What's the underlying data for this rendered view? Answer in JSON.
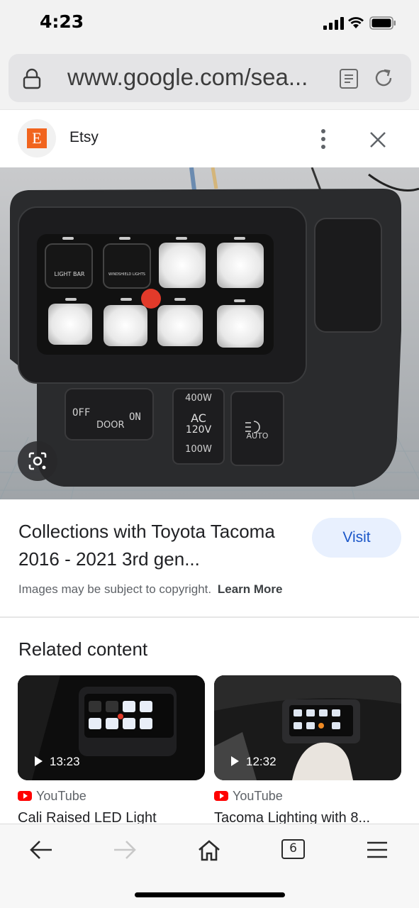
{
  "status_bar": {
    "time": "4:23"
  },
  "address_bar": {
    "url": "www.google.com/sea..."
  },
  "source": {
    "favicon_letter": "E",
    "name": "Etsy",
    "favicon_color": "#f1641e"
  },
  "image": {
    "switch_labels": [
      "LIGHT BAR",
      "WINDSHIELD LIGHTS"
    ],
    "lower_switch": {
      "off": "OFF",
      "on": "ON",
      "label": "DOOR"
    },
    "inverter": {
      "top": "400W",
      "ac": "AC",
      "voltage": "120V",
      "bottom": "100W"
    },
    "auto_label": "AUTO"
  },
  "info": {
    "title": "Collections with Toyota Tacoma 2016 - 2021 3rd gen...",
    "visit_label": "Visit",
    "copyright": "Images may be subject to copyright.",
    "learn_more": "Learn More"
  },
  "related": {
    "heading": "Related content",
    "cards": [
      {
        "duration": "13:23",
        "source": "YouTube",
        "title": "Cali Raised LED Light"
      },
      {
        "duration": "12:32",
        "source": "YouTube",
        "title": "Tacoma Lighting with 8..."
      }
    ]
  },
  "toolbar": {
    "tab_count": "6"
  },
  "colors": {
    "accent": "#1a56c8",
    "visit_bg": "#e8f0fe",
    "youtube_red": "#ff0000"
  }
}
